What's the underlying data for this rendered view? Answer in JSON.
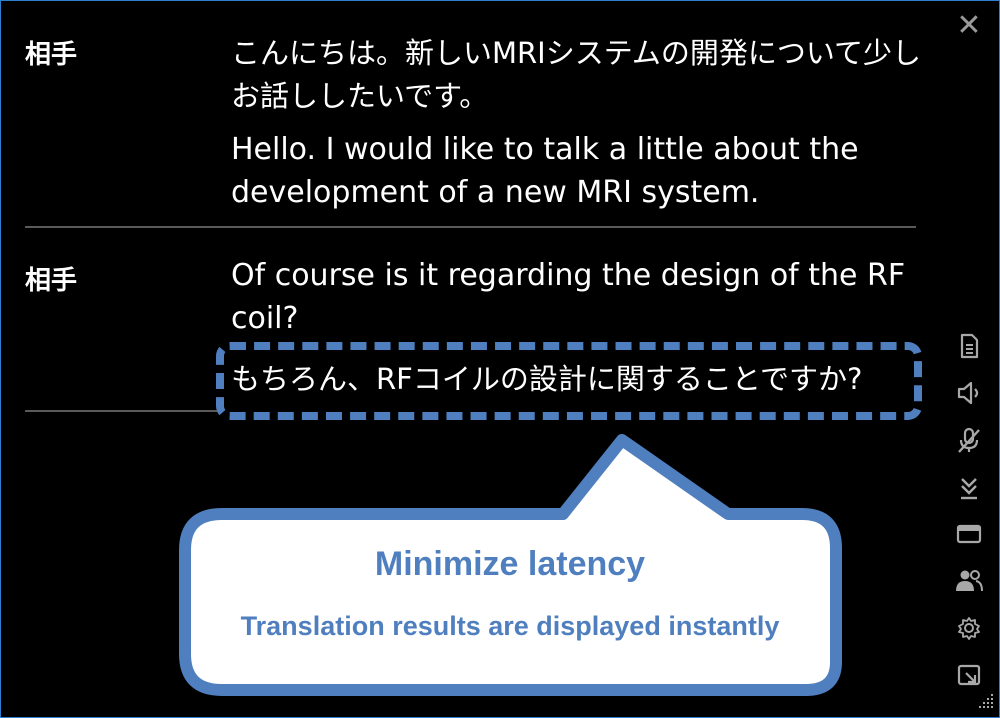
{
  "window": {
    "close_glyph": "✕"
  },
  "transcript": [
    {
      "speaker": "相手",
      "original": "こんにちは。新しいMRIシステムの開発について少しお話ししたいです。",
      "translation": "Hello. I would like to talk a little about the development of a new MRI system."
    },
    {
      "speaker": "相手",
      "original": "Of course is it regarding the design of the RF coil?",
      "translation": "もちろん、RFコイルの設計に関することですか?"
    }
  ],
  "toolbar": {
    "icons": [
      "document-icon",
      "speaker-icon",
      "mic-muted-icon",
      "scroll-down-icon",
      "window-icon",
      "users-icon",
      "gear-icon",
      "pip-icon"
    ]
  },
  "callout": {
    "title": "Minimize latency",
    "subtitle": "Translation results are displayed instantly"
  },
  "colors": {
    "background": "#000000",
    "text": "#ffffff",
    "accent": "#4f7fbe",
    "divider": "#5a5a5a",
    "icon": "#a8a8a8"
  }
}
